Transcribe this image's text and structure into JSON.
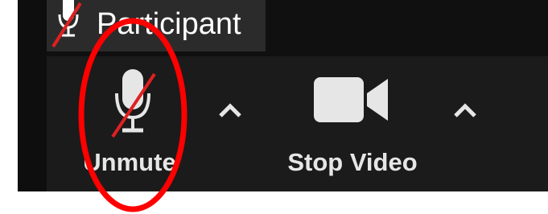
{
  "participant": {
    "name": "Participant",
    "icon": "mic-muted-icon"
  },
  "toolbar": {
    "unmute_label": "Unmute",
    "unmute_icon": "mic-muted-icon",
    "audio_caret_icon": "chevron-up-icon",
    "stop_video_label": "Stop Video",
    "video_icon": "video-camera-icon",
    "video_caret_icon": "chevron-up-icon"
  },
  "colors": {
    "background": "#1b1b1b",
    "text": "#e6e6e6",
    "muted_slash": "#e02020",
    "annotation": "#ff0000"
  }
}
